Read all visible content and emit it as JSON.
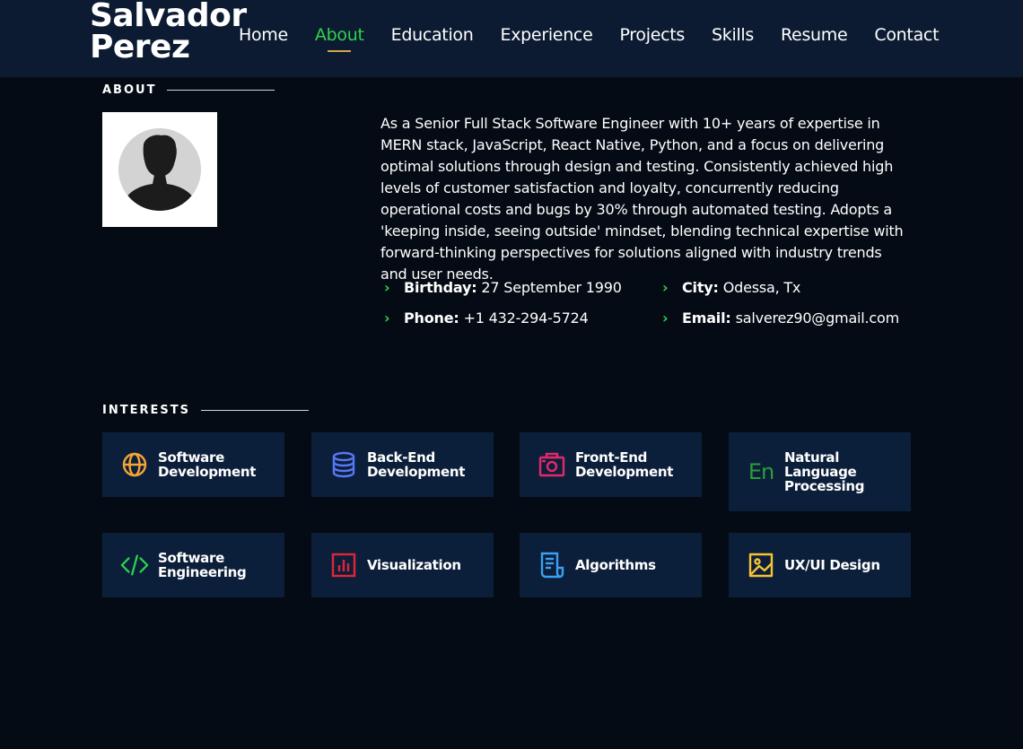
{
  "header": {
    "logo_line1": "Salvador",
    "logo_line2": "Perez",
    "nav": [
      {
        "label": "Home"
      },
      {
        "label": "About",
        "active": true
      },
      {
        "label": "Education"
      },
      {
        "label": "Experience"
      },
      {
        "label": "Projects"
      },
      {
        "label": "Skills"
      },
      {
        "label": "Resume"
      },
      {
        "label": "Contact"
      }
    ]
  },
  "about": {
    "title": "ABOUT",
    "bio": "As a Senior Full Stack Software Engineer with 10+ years of expertise in MERN stack, JavaScript, React Native, Python, and a focus on delivering optimal solutions through design and testing. Consistently achieved high levels of customer satisfaction and loyalty, concurrently reducing operational costs and bugs by 30% through automated testing. Adopts a 'keeping inside, seeing outside' mindset, blending technical expertise with forward-thinking perspectives for solutions aligned with industry trends and user needs.",
    "details": [
      {
        "label": "Birthday:",
        "value": "27 September 1990"
      },
      {
        "label": "City:",
        "value": "Odessa, Tx"
      },
      {
        "label": "Phone:",
        "value": "+1 432-294-5724"
      },
      {
        "label": "Email:",
        "value": "salverez90@gmail.com"
      }
    ]
  },
  "interests": {
    "title": "INTERESTS",
    "items": [
      {
        "label": "Software Development",
        "icon": "globe-icon",
        "color": "#f5a534"
      },
      {
        "label": "Back-End Development",
        "icon": "database-icon",
        "color": "#5777f5"
      },
      {
        "label": "Front-End Development",
        "icon": "camera-icon",
        "color": "#e3286b"
      },
      {
        "label": "Natural Language Processing",
        "icon": "language-icon",
        "color": "#2a9d3a"
      },
      {
        "label": "Software Engineering",
        "icon": "code-icon",
        "color": "#2dd34e"
      },
      {
        "label": "Visualization",
        "icon": "bar-chart-icon",
        "color": "#e22437"
      },
      {
        "label": "Algorithms",
        "icon": "document-icon",
        "color": "#3aa0f2"
      },
      {
        "label": "UX/UI Design",
        "icon": "image-icon",
        "color": "#f5c334"
      }
    ]
  }
}
